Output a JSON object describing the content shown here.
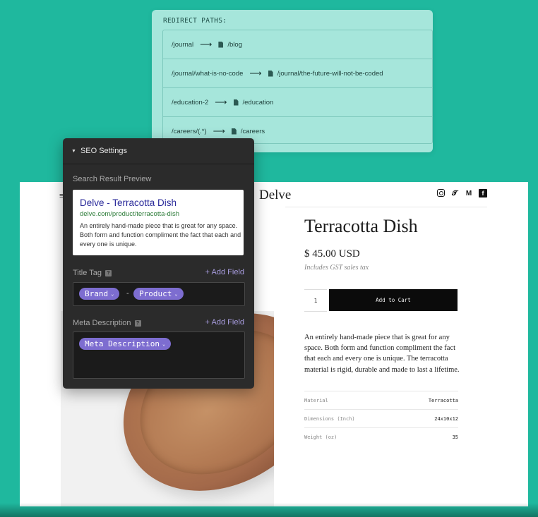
{
  "redirects": {
    "heading": "REDIRECT PATHS:",
    "rows": [
      {
        "from": "/journal",
        "to": "/blog"
      },
      {
        "from": "/journal/what-is-no-code",
        "to": "/journal/the-future-will-not-be-coded"
      },
      {
        "from": "/education-2",
        "to": "/education"
      },
      {
        "from": "/careers/(.*)",
        "to": "/careers"
      }
    ],
    "arrow": "⟶"
  },
  "seo": {
    "header": "SEO Settings",
    "preview_label": "Search Result Preview",
    "preview": {
      "title": "Delve - Terracotta Dish",
      "url": "delve.com/product/terracotta-dish",
      "description": "An entirely hand-made piece that is great for any space. Both form and function compliment the fact that each and every one is unique."
    },
    "title_tag_label": "Title Tag",
    "add_field": "+ Add Field",
    "title_chips": [
      "Brand",
      "Product"
    ],
    "title_separator": "-",
    "meta_label": "Meta Description",
    "meta_chip": "Meta Description"
  },
  "store": {
    "logo": "Delve",
    "product_title": "Terracotta Dish",
    "price": "$ 45.00 USD",
    "tax_note": "Includes GST sales tax",
    "quantity": "1",
    "add_to_cart": "Add to Cart",
    "description": "An entirely hand-made piece that is great for any space. Both form and function compliment the fact that each and every one is unique. The terracotta material is rigid, durable and made to last a lifetime.",
    "specs": [
      {
        "key": "Material",
        "value": "Terracotta"
      },
      {
        "key": "Dimensions (Inch)",
        "value": "24x10x12"
      },
      {
        "key": "Weight (oz)",
        "value": "35"
      }
    ],
    "social_icons": [
      "instagram-icon",
      "twitter-icon",
      "medium-icon",
      "facebook-icon"
    ]
  },
  "colors": {
    "background": "#1fb89e",
    "redirect_panel": "#a6e6db",
    "seo_panel": "#2b2b2b",
    "chip": "#7d6dd0",
    "add_field": "#a99de0"
  }
}
